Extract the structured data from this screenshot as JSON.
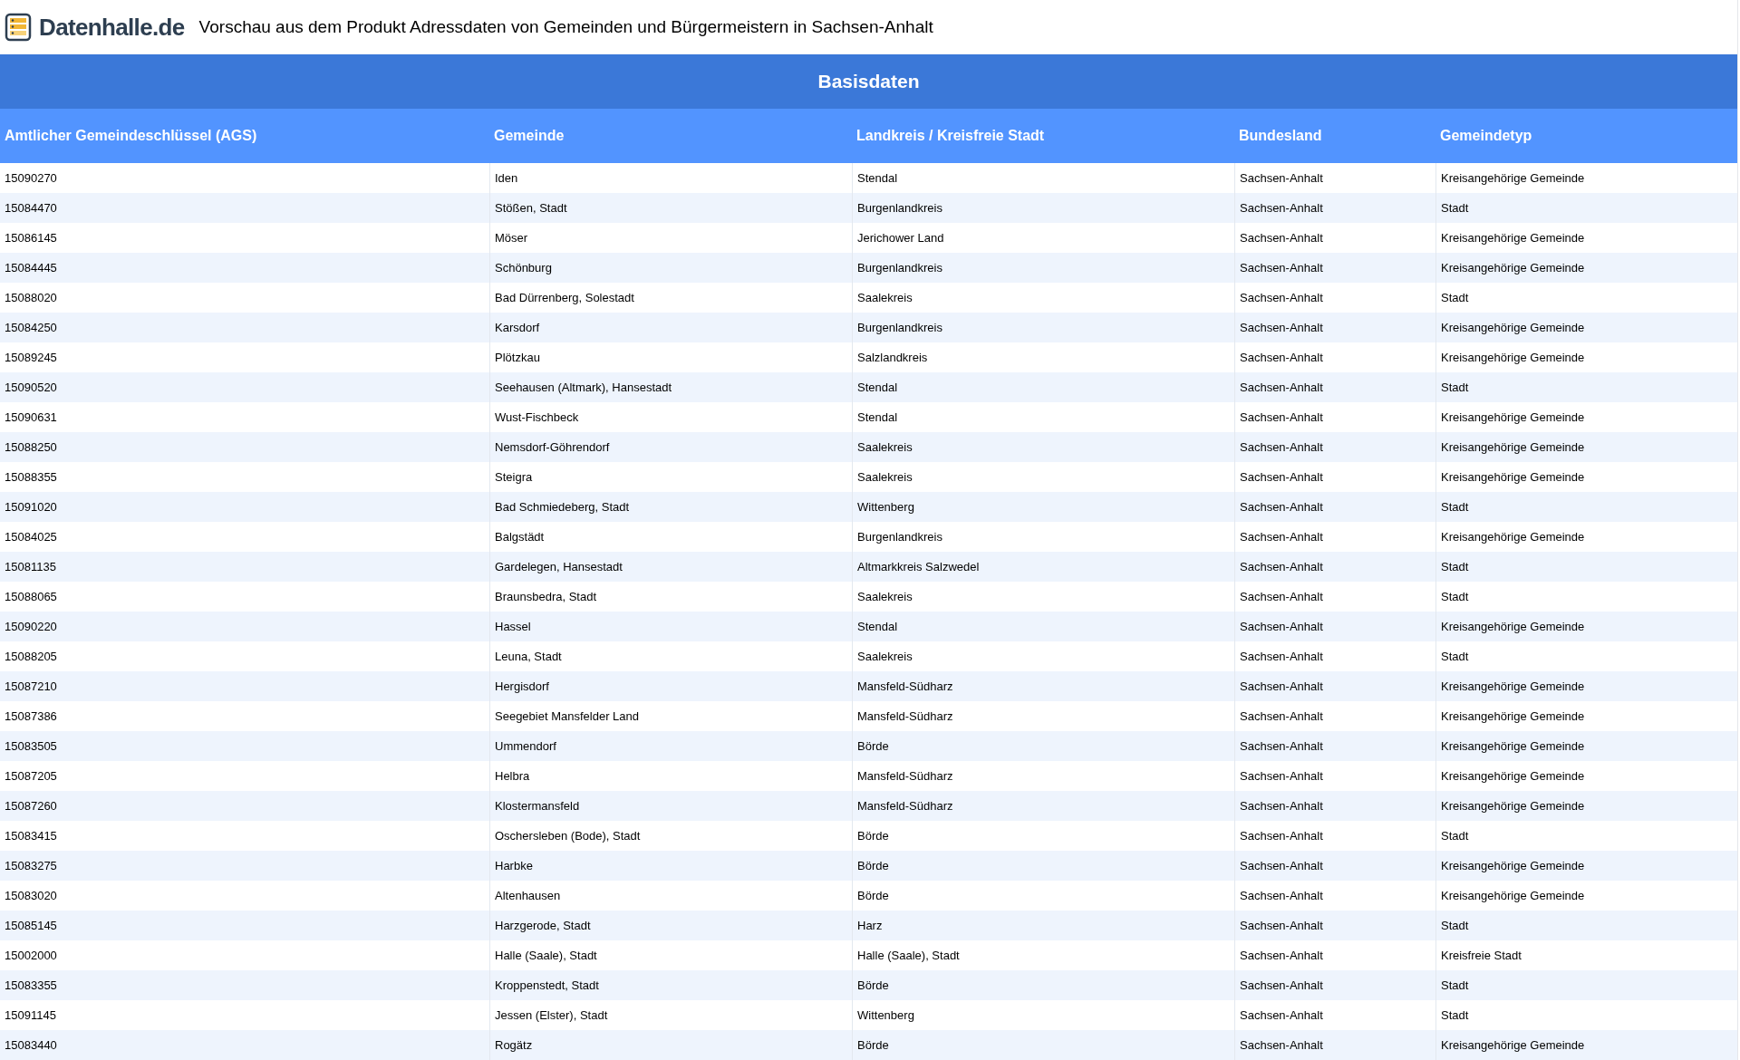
{
  "header": {
    "logo": "Datenhalle.de",
    "title": "Vorschau aus dem Produkt Adressdaten von Gemeinden und Bürgermeistern in Sachsen-Anhalt"
  },
  "section": "Basisdaten",
  "table": {
    "columns": [
      "Amtlicher Gemeindeschlüssel (AGS)",
      "Gemeinde",
      "Landkreis / Kreisfreie Stadt",
      "Bundesland",
      "Gemeindetyp"
    ],
    "rows": [
      [
        "15090270",
        "Iden",
        "Stendal",
        "Sachsen-Anhalt",
        "Kreisangehörige Gemeinde"
      ],
      [
        "15084470",
        "Stößen, Stadt",
        "Burgenlandkreis",
        "Sachsen-Anhalt",
        "Stadt"
      ],
      [
        "15086145",
        "Möser",
        "Jerichower Land",
        "Sachsen-Anhalt",
        "Kreisangehörige Gemeinde"
      ],
      [
        "15084445",
        "Schönburg",
        "Burgenlandkreis",
        "Sachsen-Anhalt",
        "Kreisangehörige Gemeinde"
      ],
      [
        "15088020",
        "Bad Dürrenberg, Solestadt",
        "Saalekreis",
        "Sachsen-Anhalt",
        "Stadt"
      ],
      [
        "15084250",
        "Karsdorf",
        "Burgenlandkreis",
        "Sachsen-Anhalt",
        "Kreisangehörige Gemeinde"
      ],
      [
        "15089245",
        "Plötzkau",
        "Salzlandkreis",
        "Sachsen-Anhalt",
        "Kreisangehörige Gemeinde"
      ],
      [
        "15090520",
        "Seehausen (Altmark), Hansestadt",
        "Stendal",
        "Sachsen-Anhalt",
        "Stadt"
      ],
      [
        "15090631",
        "Wust-Fischbeck",
        "Stendal",
        "Sachsen-Anhalt",
        "Kreisangehörige Gemeinde"
      ],
      [
        "15088250",
        "Nemsdorf-Göhrendorf",
        "Saalekreis",
        "Sachsen-Anhalt",
        "Kreisangehörige Gemeinde"
      ],
      [
        "15088355",
        "Steigra",
        "Saalekreis",
        "Sachsen-Anhalt",
        "Kreisangehörige Gemeinde"
      ],
      [
        "15091020",
        "Bad Schmiedeberg, Stadt",
        "Wittenberg",
        "Sachsen-Anhalt",
        "Stadt"
      ],
      [
        "15084025",
        "Balgstädt",
        "Burgenlandkreis",
        "Sachsen-Anhalt",
        "Kreisangehörige Gemeinde"
      ],
      [
        "15081135",
        "Gardelegen, Hansestadt",
        "Altmarkkreis Salzwedel",
        "Sachsen-Anhalt",
        "Stadt"
      ],
      [
        "15088065",
        "Braunsbedra, Stadt",
        "Saalekreis",
        "Sachsen-Anhalt",
        "Stadt"
      ],
      [
        "15090220",
        "Hassel",
        "Stendal",
        "Sachsen-Anhalt",
        "Kreisangehörige Gemeinde"
      ],
      [
        "15088205",
        "Leuna, Stadt",
        "Saalekreis",
        "Sachsen-Anhalt",
        "Stadt"
      ],
      [
        "15087210",
        "Hergisdorf",
        "Mansfeld-Südharz",
        "Sachsen-Anhalt",
        "Kreisangehörige Gemeinde"
      ],
      [
        "15087386",
        "Seegebiet Mansfelder Land",
        "Mansfeld-Südharz",
        "Sachsen-Anhalt",
        "Kreisangehörige Gemeinde"
      ],
      [
        "15083505",
        "Ummendorf",
        "Börde",
        "Sachsen-Anhalt",
        "Kreisangehörige Gemeinde"
      ],
      [
        "15087205",
        "Helbra",
        "Mansfeld-Südharz",
        "Sachsen-Anhalt",
        "Kreisangehörige Gemeinde"
      ],
      [
        "15087260",
        "Klostermansfeld",
        "Mansfeld-Südharz",
        "Sachsen-Anhalt",
        "Kreisangehörige Gemeinde"
      ],
      [
        "15083415",
        "Oschersleben (Bode), Stadt",
        "Börde",
        "Sachsen-Anhalt",
        "Stadt"
      ],
      [
        "15083275",
        "Harbke",
        "Börde",
        "Sachsen-Anhalt",
        "Kreisangehörige Gemeinde"
      ],
      [
        "15083020",
        "Altenhausen",
        "Börde",
        "Sachsen-Anhalt",
        "Kreisangehörige Gemeinde"
      ],
      [
        "15085145",
        "Harzgerode, Stadt",
        "Harz",
        "Sachsen-Anhalt",
        "Stadt"
      ],
      [
        "15002000",
        "Halle (Saale), Stadt",
        "Halle (Saale), Stadt",
        "Sachsen-Anhalt",
        "Kreisfreie Stadt"
      ],
      [
        "15083355",
        "Kroppenstedt, Stadt",
        "Börde",
        "Sachsen-Anhalt",
        "Stadt"
      ],
      [
        "15091145",
        "Jessen (Elster), Stadt",
        "Wittenberg",
        "Sachsen-Anhalt",
        "Stadt"
      ],
      [
        "15083440",
        "Rogätz",
        "Börde",
        "Sachsen-Anhalt",
        "Kreisangehörige Gemeinde"
      ]
    ]
  }
}
